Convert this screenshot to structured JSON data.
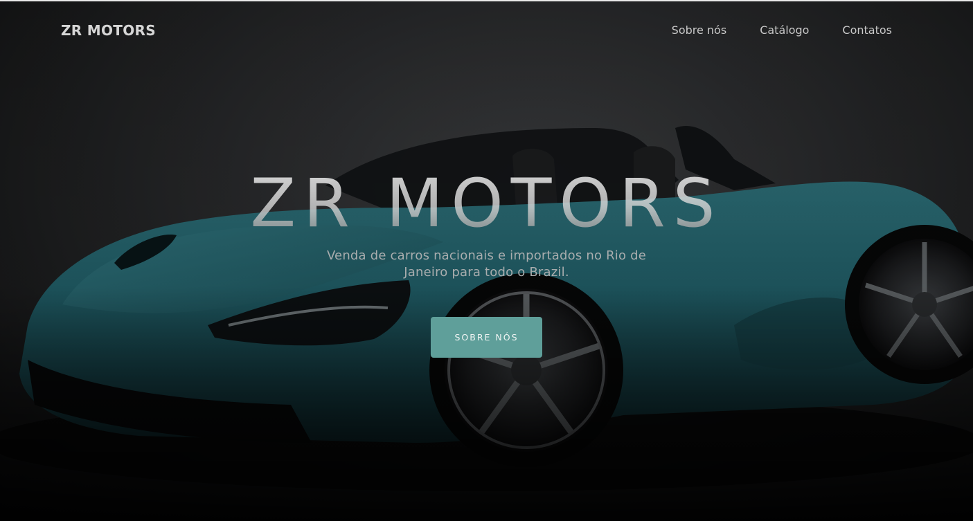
{
  "navbar": {
    "brand": "ZR MOTORS",
    "links": [
      "Sobre nós",
      "Catálogo",
      "Contatos"
    ]
  },
  "hero": {
    "title": "ZR MOTORS",
    "subtitle": "Venda de carros nacionais e importados no Rio de Janeiro para todo o Brazil.",
    "button_label": "SOBRE NÓS",
    "image": "sports-car-photo"
  },
  "colors": {
    "accent": "#5f9f9a",
    "car": "#1f5a63",
    "background": "#1c1d1e"
  }
}
